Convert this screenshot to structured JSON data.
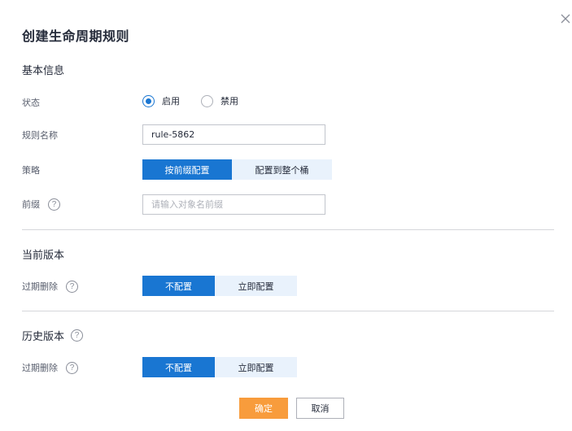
{
  "dialog": {
    "title": "创建生命周期规则",
    "close_icon": "close-icon"
  },
  "basic": {
    "section_title": "基本信息",
    "status": {
      "label": "状态",
      "options": [
        "启用",
        "禁用"
      ],
      "selected": "启用"
    },
    "rule_name": {
      "label": "规则名称",
      "value": "rule-5862"
    },
    "policy": {
      "label": "策略",
      "options": [
        "按前缀配置",
        "配置到整个桶"
      ],
      "selected": "按前缀配置"
    },
    "prefix": {
      "label": "前缀",
      "placeholder": "请输入对象名前缀",
      "help_icon": "question-circle-icon"
    }
  },
  "current_version": {
    "section_title": "当前版本",
    "expire_delete": {
      "label": "过期删除",
      "options": [
        "不配置",
        "立即配置"
      ],
      "selected": "不配置"
    }
  },
  "history_version": {
    "section_title": "历史版本",
    "expire_delete": {
      "label": "过期删除",
      "options": [
        "不配置",
        "立即配置"
      ],
      "selected": "不配置"
    }
  },
  "footer": {
    "ok_label": "确定",
    "cancel_label": "取消"
  },
  "colors": {
    "primary": "#1976d2",
    "segment_inactive": "#e9f2fc",
    "ok_button": "#f89c3c"
  }
}
